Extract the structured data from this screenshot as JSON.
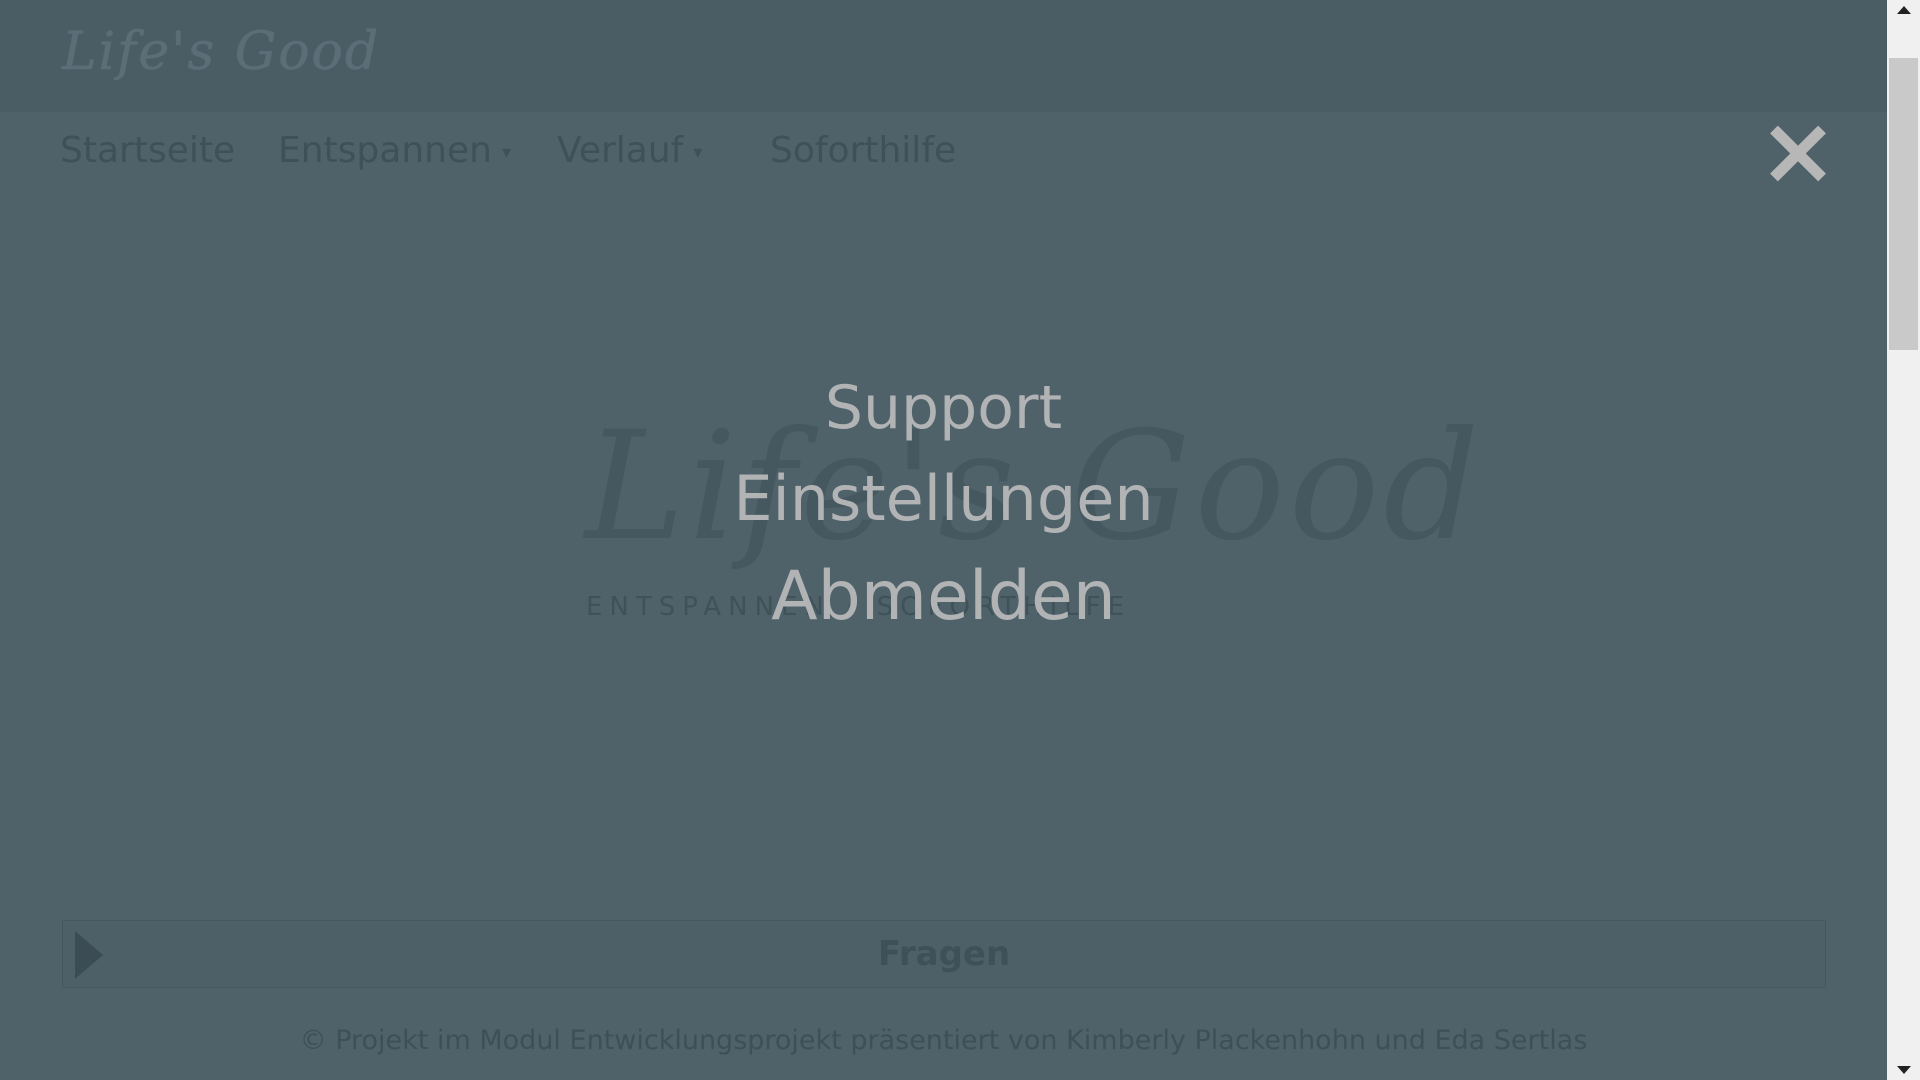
{
  "header": {
    "logo_text": "Life's Good"
  },
  "nav": {
    "items": [
      {
        "label": "Startseite"
      },
      {
        "label": "Entspannen",
        "caret": "▾"
      },
      {
        "label": "Verlauf",
        "caret": "▾"
      },
      {
        "label": "Soforthilfe"
      }
    ]
  },
  "hero": {
    "logo_text": "Life's Good",
    "tagline": "ENTSPANNEN · SOFORTHILFE"
  },
  "accordion": {
    "label": "Fragen",
    "icon": "play-arrow-icon"
  },
  "footer": {
    "text": "© Projekt im Modul Entwicklungsprojekt präsentiert von Kimberly Plackenhohn und Eda Sertlas"
  },
  "overlay_menu": {
    "close_icon": "close-icon",
    "items": [
      {
        "label": "Support"
      },
      {
        "label": "Einstellungen"
      },
      {
        "label": "Abmelden"
      }
    ]
  },
  "colors": {
    "overlay_bg": "#4f6169",
    "overlay_text": "#b1b3b4",
    "close_icon": "#b7b7b7"
  }
}
